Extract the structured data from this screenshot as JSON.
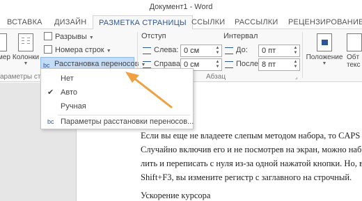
{
  "window": {
    "title": "Документ1 - Word"
  },
  "tabs": [
    "ВСТАВКА",
    "ДИЗАЙН",
    "РАЗМЕТКА СТРАНИЦЫ",
    "ССЫЛКИ",
    "РАССЫЛКИ",
    "РЕЦЕНЗИРОВАНИЕ"
  ],
  "ribbon": {
    "page_setup": {
      "size_label": "мер",
      "columns_label": "Колонки",
      "breaks_label": "Разрывы",
      "line_numbers_label": "Номера строк",
      "hyphenation_label": "Расстановка переносов",
      "group_label": "араметры стран"
    },
    "paragraph": {
      "indent_heading": "Отступ",
      "left_label": "Слева:",
      "left_value": "0 см",
      "right_label": "Справа:",
      "right_value": "0 см",
      "spacing_heading": "Интервал",
      "before_label": "До:",
      "before_value": "0 пт",
      "after_label": "После:",
      "after_value": "8 пт",
      "group_label": "Абзац"
    },
    "arrange": {
      "position_label": "Положение",
      "wrap_label": "Обт",
      "wrap_label2": "текс"
    }
  },
  "hyphenation_menu": {
    "items": [
      "Нет",
      "Авто",
      "Ручная"
    ],
    "checked": "Авто",
    "options_label": "Параметры расстановки переносов..."
  },
  "document": {
    "lines": [
      "Если вы еще не владеете слепым методом набора, то CAPS LO",
      "Случайно включив его и не посмотрев на экран, можно набра",
      "лить и переписать с нуля из-за одной нажатой кнопки. Но, вы",
      "Shift+F3, вы измените регистр с заглавного на строчный."
    ],
    "heading": "Ускорение курсора"
  },
  "colors": {
    "accent": "#2b579a",
    "arrow": "#f0a040",
    "highlight": "#c5dcf6"
  }
}
